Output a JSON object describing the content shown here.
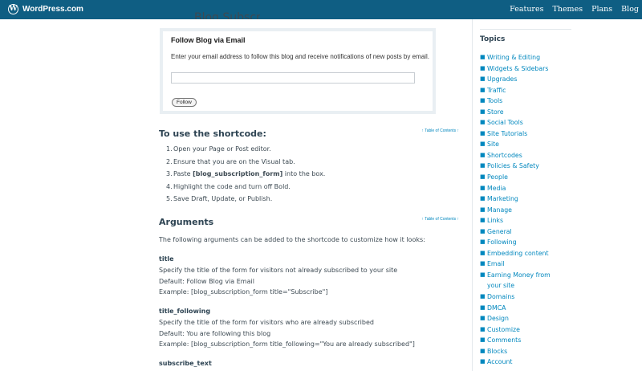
{
  "header": {
    "brand": "WordPress.com",
    "logo_letter": "W",
    "nav": [
      "Features",
      "Themes",
      "Plans",
      "Blog"
    ]
  },
  "page": {
    "title_cutoff": "Blog Subscriptions"
  },
  "widget": {
    "title": "Follow Blog via Email",
    "description": "Enter your email address to follow this blog and receive notifications of new posts by email.",
    "email_value": "",
    "button": "Follow"
  },
  "toc_link": "↑ Table of Contents ↑",
  "shortcode": {
    "heading": "To use the shortcode:",
    "steps": [
      {
        "num": "1.",
        "pre": "Open your Page or Post editor.",
        "bold": "",
        "post": ""
      },
      {
        "num": "2.",
        "pre": "Ensure that you are on the Visual tab.",
        "bold": "",
        "post": ""
      },
      {
        "num": "3.",
        "pre": "Paste ",
        "bold": "[blog_subscription_form]",
        "post": " into the box."
      },
      {
        "num": "4.",
        "pre": "Highlight the code and turn off Bold.",
        "bold": "",
        "post": ""
      },
      {
        "num": "5.",
        "pre": "Save Draft, Update, or Publish.",
        "bold": "",
        "post": ""
      }
    ]
  },
  "arguments": {
    "heading": "Arguments",
    "intro": "The following arguments can be added to the shortcode to customize how it looks:",
    "items": [
      {
        "name": "title",
        "desc": "Specify the title of the form for visitors not already subscribed to your site",
        "default": "Default: Follow Blog via Email",
        "example": "Example: [blog_subscription_form title=\"Subscribe\"]"
      },
      {
        "name": "title_following",
        "desc": "Specify the title of the form for visitors who are already subscribed",
        "default": "Default: You are following this blog",
        "example": "Example: [blog_subscription_form title_following=\"You are already subscribed\"]"
      },
      {
        "name": "subscribe_text",
        "desc": "",
        "default": "",
        "example": ""
      }
    ]
  },
  "sidebar": {
    "title": "Topics",
    "bullet": "■",
    "topics": [
      [
        "Writing & Editing"
      ],
      [
        "Widgets & Sidebars"
      ],
      [
        "Upgrades"
      ],
      [
        "Traffic"
      ],
      [
        "Tools"
      ],
      [
        "Store"
      ],
      [
        "Social Tools"
      ],
      [
        "Site Tutorials"
      ],
      [
        "Site"
      ],
      [
        "Shortcodes"
      ],
      [
        "Policies & Safety"
      ],
      [
        "People"
      ],
      [
        "Media"
      ],
      [
        "Marketing"
      ],
      [
        "Manage"
      ],
      [
        "Links"
      ],
      [
        "General"
      ],
      [
        "Following"
      ],
      [
        "Embedding content"
      ],
      [
        "Email"
      ],
      [
        "Earning Money from",
        "your site"
      ],
      [
        "Domains"
      ],
      [
        "DMCA"
      ],
      [
        "Design"
      ],
      [
        "Customize"
      ],
      [
        "Comments"
      ],
      [
        "Blocks"
      ],
      [
        "Account"
      ]
    ]
  }
}
